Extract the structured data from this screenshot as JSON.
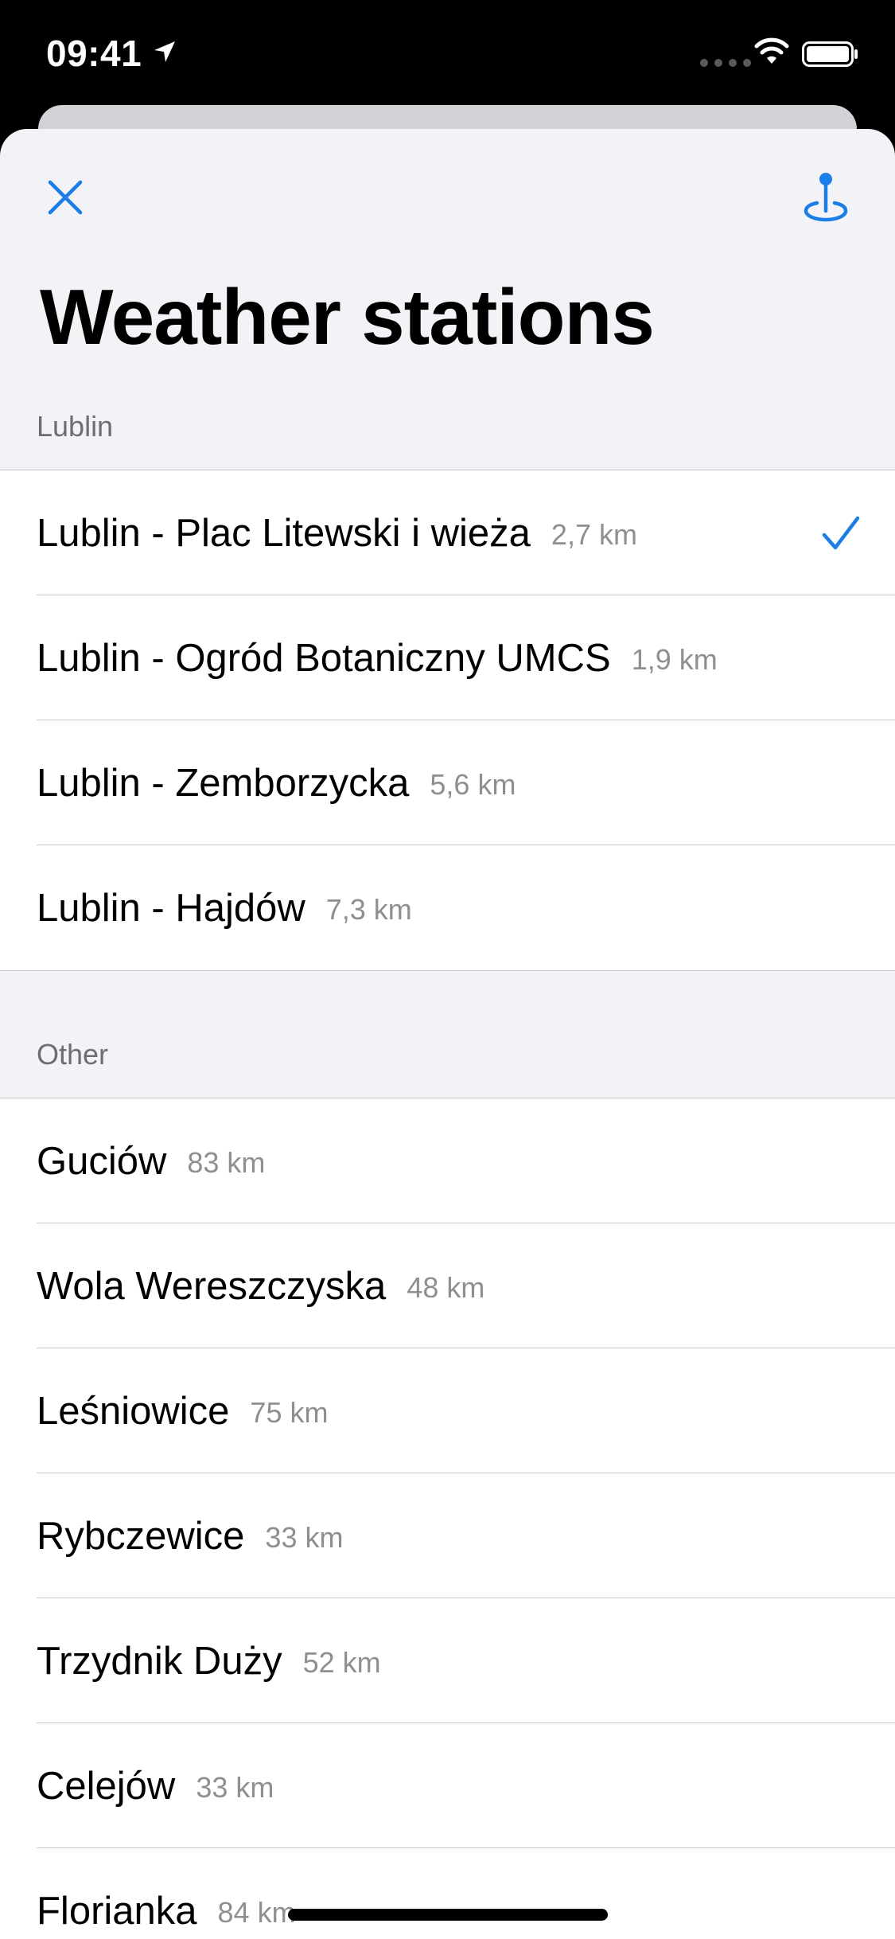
{
  "status_bar": {
    "time": "09:41"
  },
  "header": {
    "title": "Weather stations",
    "close_icon": "close-icon",
    "location_icon": "map-pin-icon"
  },
  "accent_color": "#1a7ee6",
  "sections": [
    {
      "title": "Lublin",
      "items": [
        {
          "name": "Lublin - Plac Litewski i wieża",
          "distance": "2,7 km",
          "selected": true
        },
        {
          "name": "Lublin - Ogród Botaniczny UMCS",
          "distance": "1,9 km",
          "selected": false
        },
        {
          "name": "Lublin - Zemborzycka",
          "distance": "5,6 km",
          "selected": false
        },
        {
          "name": "Lublin - Hajdów",
          "distance": "7,3 km",
          "selected": false
        }
      ]
    },
    {
      "title": "Other",
      "items": [
        {
          "name": "Guciów",
          "distance": "83 km"
        },
        {
          "name": "Wola Wereszczyska",
          "distance": "48 km"
        },
        {
          "name": "Leśniowice",
          "distance": "75 km"
        },
        {
          "name": "Rybczewice",
          "distance": "33 km"
        },
        {
          "name": "Trzydnik Duży",
          "distance": "52 km"
        },
        {
          "name": "Celejów",
          "distance": "33 km"
        },
        {
          "name": "Florianka",
          "distance": "84 km"
        }
      ]
    }
  ]
}
